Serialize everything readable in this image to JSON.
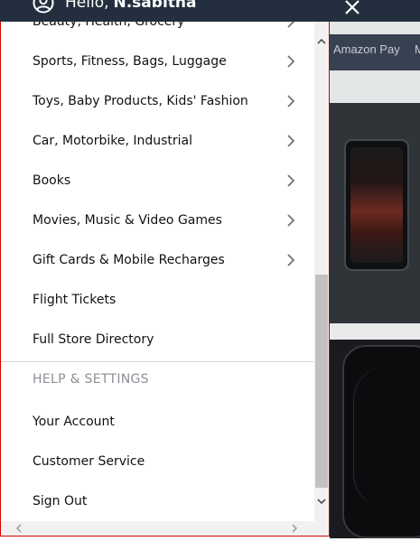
{
  "header": {
    "greeting": "Hello,",
    "user_name": "N.sabitha"
  },
  "background": {
    "nav_label": "Amazon Pay",
    "nav_extra": "M"
  },
  "menu": {
    "items": [
      {
        "label": "Beauty, Health, Grocery",
        "has_arrow": true
      },
      {
        "label": "Sports, Fitness, Bags, Luggage",
        "has_arrow": true
      },
      {
        "label": "Toys, Baby Products, Kids' Fashion",
        "has_arrow": true
      },
      {
        "label": "Car, Motorbike, Industrial",
        "has_arrow": true
      },
      {
        "label": "Books",
        "has_arrow": true
      },
      {
        "label": "Movies, Music & Video Games",
        "has_arrow": true
      },
      {
        "label": "Gift Cards & Mobile Recharges",
        "has_arrow": true
      },
      {
        "label": "Flight Tickets",
        "has_arrow": false
      },
      {
        "label": "Full Store Directory",
        "has_arrow": false
      }
    ],
    "section_title": "HELP & SETTINGS",
    "settings_items": [
      {
        "label": "Your Account"
      },
      {
        "label": "Customer Service"
      },
      {
        "label": "Sign Out"
      }
    ]
  },
  "icons": {
    "avatar": "user-circle-icon",
    "close": "close-x-icon",
    "item_arrow": "chevron-right-icon"
  },
  "colors": {
    "header_bg": "#232f3e",
    "drawer_border": "#d40000",
    "section_title": "#8b8f94"
  }
}
